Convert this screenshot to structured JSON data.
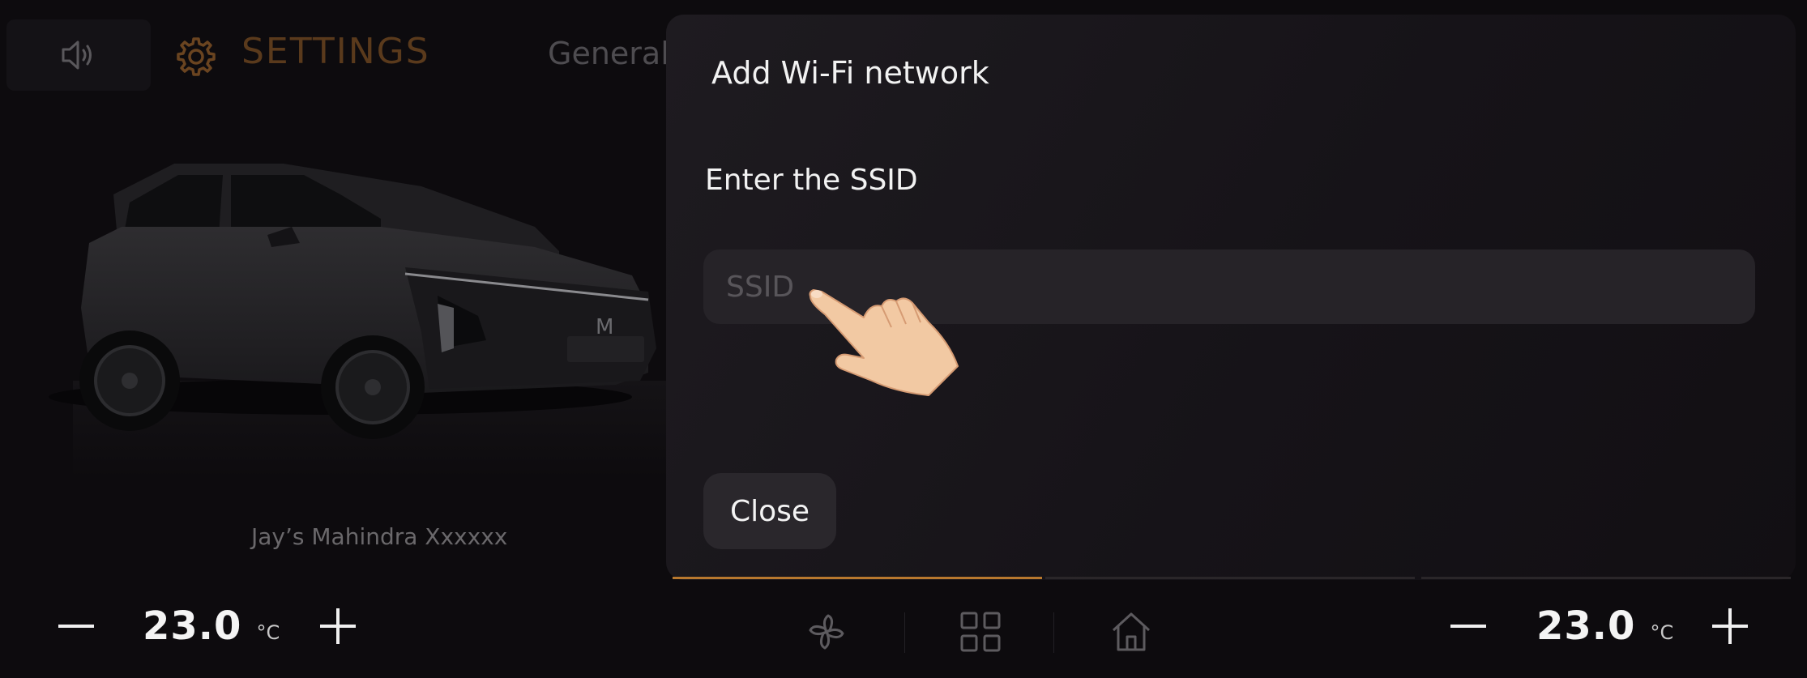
{
  "header": {
    "title": "SETTINGS",
    "tab_label": "General",
    "volume_icon": "speaker-icon",
    "settings_icon": "gear-icon"
  },
  "vehicle": {
    "name": "Jay’s Mahindra Xxxxxx"
  },
  "dialog": {
    "title": "Add Wi-Fi network",
    "ssid_label": "Enter the SSID",
    "ssid_placeholder": "SSID",
    "ssid_value": "",
    "close_label": "Close"
  },
  "climate_left": {
    "temperature": "23.0",
    "unit": "°C"
  },
  "climate_right": {
    "temperature": "23.0",
    "unit": "°C"
  },
  "bottom_nav": {
    "icons": [
      "fan-icon",
      "apps-grid-icon",
      "home-icon"
    ]
  },
  "colors": {
    "accent": "#c07a2c",
    "background": "#0d0b0e",
    "dialog_background": "#1a171c",
    "input_background": "#262328"
  }
}
